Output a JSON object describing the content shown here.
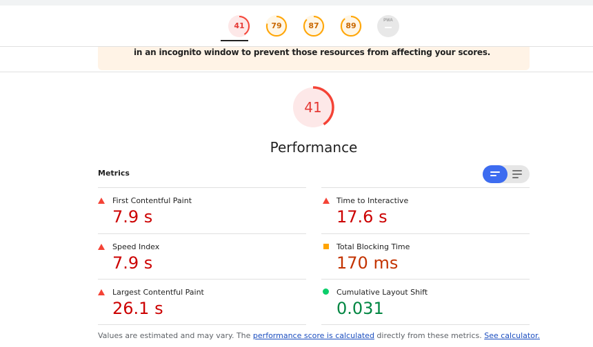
{
  "score_tabs": [
    {
      "name": "performance",
      "score": "41",
      "rating": "fail",
      "fraction": 0.41
    },
    {
      "name": "accessibility",
      "score": "79",
      "rating": "average",
      "fraction": 0.79
    },
    {
      "name": "best-practices",
      "score": "87",
      "rating": "average",
      "fraction": 0.87
    },
    {
      "name": "seo",
      "score": "89",
      "rating": "average",
      "fraction": 0.89
    },
    {
      "name": "pwa",
      "label": "PWA",
      "score": "—"
    }
  ],
  "notice": {
    "text": "in an incognito window to prevent those resources from affecting your scores."
  },
  "category": {
    "score": "41",
    "fraction": 0.41,
    "title": "Performance"
  },
  "metrics": {
    "heading": "Metrics",
    "items": [
      {
        "label": "First Contentful Paint",
        "value": "7.9 s",
        "rating": "fail"
      },
      {
        "label": "Time to Interactive",
        "value": "17.6 s",
        "rating": "fail"
      },
      {
        "label": "Speed Index",
        "value": "7.9 s",
        "rating": "fail"
      },
      {
        "label": "Total Blocking Time",
        "value": "170 ms",
        "rating": "average"
      },
      {
        "label": "Largest Contentful Paint",
        "value": "26.1 s",
        "rating": "fail"
      },
      {
        "label": "Cumulative Layout Shift",
        "value": "0.031",
        "rating": "pass"
      }
    ]
  },
  "footer": {
    "text_before": "Values are estimated and may vary. The ",
    "link1": "performance score is calculated",
    "text_middle": " directly from these metrics. ",
    "link2": "See calculator."
  },
  "colors": {
    "fail": "#e53935",
    "average": "#ffa400",
    "pass": "#0cce6b",
    "toggle_active": "#3d6cf0"
  }
}
